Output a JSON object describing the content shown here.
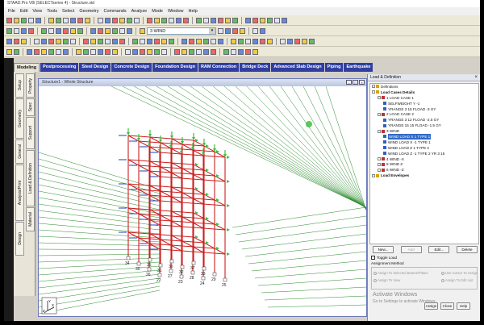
{
  "app": {
    "title": "STAAD.Pro V8i (SELECTseries 4) - Structure.std",
    "menu": [
      "File",
      "Edit",
      "View",
      "Tools",
      "Select",
      "Geometry",
      "Commands",
      "Analyze",
      "Mode",
      "Window",
      "Help"
    ],
    "view_combo": "3 WIND"
  },
  "ribbon_tabs": [
    {
      "label": "Modeling",
      "active": true
    },
    {
      "label": "Postprocessing",
      "active": false
    },
    {
      "label": "Steel Design",
      "active": false
    },
    {
      "label": "Concrete Design",
      "active": false
    },
    {
      "label": "Foundation Design",
      "active": false
    },
    {
      "label": "RAM Connection",
      "active": false
    },
    {
      "label": "Bridge Deck",
      "active": false
    },
    {
      "label": "Advanced Slab Design",
      "active": false
    },
    {
      "label": "Piping",
      "active": false
    },
    {
      "label": "Earthquake",
      "active": false
    }
  ],
  "side_tabs": {
    "outer": [
      "Setup",
      "Geometry",
      "General",
      "Analysis/Print",
      "Design"
    ],
    "inner": [
      "Property",
      "Spec",
      "Support",
      "Load & Definition",
      "Material"
    ]
  },
  "viewport": {
    "title": "Structure1 - Whole Structure",
    "axis_labels": {
      "y": "Y",
      "x": "X",
      "z": "Z"
    },
    "node_labels": [
      "22",
      "23",
      "24",
      "25",
      "26",
      "27",
      "28",
      "29",
      "30",
      "31",
      "32",
      "33",
      "34",
      "35",
      "36",
      "37"
    ]
  },
  "panel": {
    "title": "Load & Definition",
    "close": "×",
    "tree": [
      {
        "label": "Definitions",
        "indent": 0,
        "icon": "folder",
        "bold": false
      },
      {
        "label": "Load Cases Details",
        "indent": 0,
        "icon": "folder",
        "bold": true
      },
      {
        "label": "1 LOAD CASE 1",
        "indent": 1,
        "icon": "case",
        "bold": false
      },
      {
        "label": "SELFWEIGHT Y -1",
        "indent": 2,
        "icon": "load",
        "bold": false
      },
      {
        "label": "YRANGE 3 15 FLOAD -3 GY",
        "indent": 2,
        "icon": "load",
        "bold": false
      },
      {
        "label": "2 LOAD CASE 2",
        "indent": 1,
        "icon": "case",
        "bold": false
      },
      {
        "label": "YRANGE 3 12 FLOAD -2.5 GY",
        "indent": 2,
        "icon": "load",
        "bold": false
      },
      {
        "label": "YRANGE 15 15 FLOAD -1.5 GY",
        "indent": 2,
        "icon": "load",
        "bold": false
      },
      {
        "label": "3 WIND",
        "indent": 1,
        "icon": "case",
        "bold": false
      },
      {
        "label": "WIND LOAD X 1 TYPE 1",
        "indent": 2,
        "icon": "load",
        "bold": false,
        "selected": true
      },
      {
        "label": "WIND LOAD X -1 TYPE 1",
        "indent": 2,
        "icon": "load",
        "bold": false
      },
      {
        "label": "WIND LOAD Z 1 TYPE 2",
        "indent": 2,
        "icon": "load",
        "bold": false
      },
      {
        "label": "WIND LOAD Z -1 TYPE 2 YR 3 15",
        "indent": 2,
        "icon": "load",
        "bold": false
      },
      {
        "label": "4 WIND -X",
        "indent": 1,
        "icon": "case",
        "bold": false
      },
      {
        "label": "5 WIND Z",
        "indent": 1,
        "icon": "case",
        "bold": false
      },
      {
        "label": "6 WIND -Z",
        "indent": 1,
        "icon": "case",
        "bold": false
      },
      {
        "label": "Load Envelopes",
        "indent": 0,
        "icon": "folder",
        "bold": true
      }
    ],
    "buttons": {
      "new": "New...",
      "add": "Add",
      "edit": "Edit...",
      "delete": "Delete"
    },
    "toggle_load": "Toggle Load",
    "assignment_method": "Assignment Method",
    "radios": {
      "selected": "Assign To Selected Beams/Plates",
      "cursor": "Use Cursor To Assign",
      "view": "Assign To View",
      "edit_list": "Assign To Edit List"
    },
    "bottom_buttons": {
      "assign": "Assign",
      "close": "Close",
      "help": "Help"
    },
    "watermark": {
      "line1": "Activate Windows",
      "line2": "Go to Settings to activate Windows."
    }
  },
  "colors": {
    "structure": "#cc1f1f",
    "load_arrows": "#3fbf3f",
    "wind_lines": "#2b8a2b",
    "supports": "#1f3fbf",
    "selection": "#316ac5"
  }
}
